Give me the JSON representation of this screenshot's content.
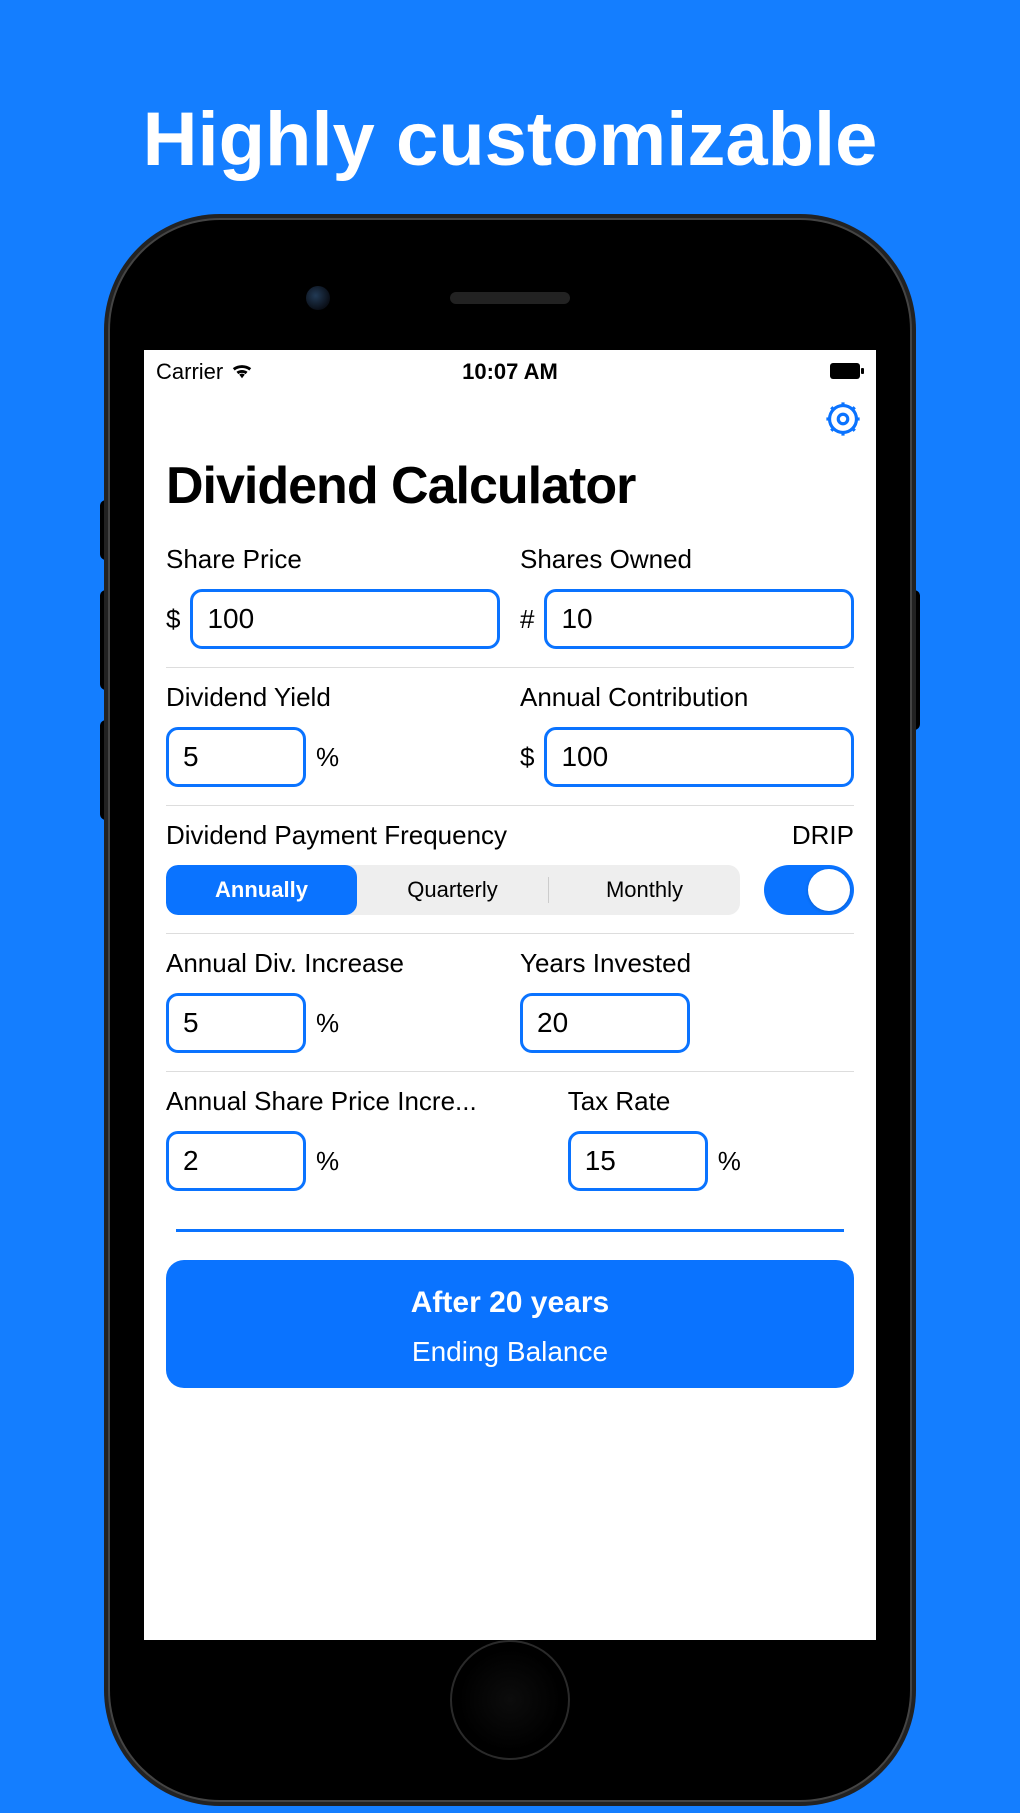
{
  "promo": {
    "title": "Highly customizable"
  },
  "status": {
    "carrier": "Carrier",
    "time": "10:07 AM"
  },
  "app": {
    "title": "Dividend Calculator",
    "share_price": {
      "label": "Share Price",
      "prefix": "$",
      "value": "100"
    },
    "shares_owned": {
      "label": "Shares Owned",
      "prefix": "#",
      "value": "10"
    },
    "dividend_yield": {
      "label": "Dividend Yield",
      "value": "5",
      "suffix": "%"
    },
    "annual_contribution": {
      "label": "Annual Contribution",
      "prefix": "$",
      "value": "100"
    },
    "frequency": {
      "label": "Dividend Payment Frequency",
      "drip_label": "DRIP",
      "options": [
        "Annually",
        "Quarterly",
        "Monthly"
      ],
      "selected": "Annually",
      "drip_on": true
    },
    "annual_div_increase": {
      "label": "Annual Div. Increase",
      "value": "5",
      "suffix": "%"
    },
    "years_invested": {
      "label": "Years Invested",
      "value": "20"
    },
    "share_price_increase": {
      "label": "Annual Share Price Incre...",
      "value": "2",
      "suffix": "%"
    },
    "tax_rate": {
      "label": "Tax Rate",
      "value": "15",
      "suffix": "%"
    },
    "result": {
      "title": "After 20 years",
      "subtitle": "Ending Balance"
    }
  }
}
